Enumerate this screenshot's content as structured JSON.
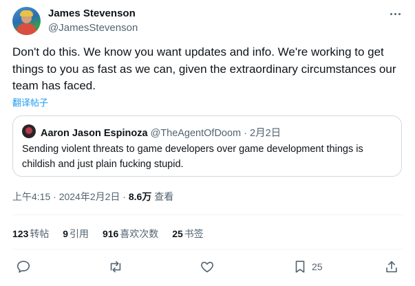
{
  "author": {
    "display_name": "James Stevenson",
    "handle": "@JamesStevenson"
  },
  "tweet": {
    "text": "Don't do this. We know you want updates and info. We're working to get things to you as fast as we can, given the extraordinary circumstances our team has faced.",
    "translate_label": "翻译帖子"
  },
  "quote": {
    "name": "Aaron Jason Espinoza",
    "handle": "@TheAgentOfDoom",
    "separator": " · ",
    "date": "2月2日",
    "text": "Sending violent threats to game developers over game development things is childish and just plain fucking stupid."
  },
  "meta": {
    "time": "上午4:15",
    "separator": " · ",
    "date": "2024年2月2日",
    "separator2": " · ",
    "views_count": "8.6万",
    "views_label": "查看"
  },
  "stats": {
    "reposts": {
      "count": "123",
      "label": "转帖"
    },
    "quotes": {
      "count": "9",
      "label": "引用"
    },
    "likes": {
      "count": "916",
      "label": "喜欢次数"
    },
    "bookmarks": {
      "count": "25",
      "label": "书签"
    }
  },
  "actions": {
    "reply_icon": "reply-icon",
    "repost_icon": "repost-icon",
    "like_icon": "heart-icon",
    "bookmark_icon": "bookmark-icon",
    "bookmark_count": "25",
    "share_icon": "share-icon"
  },
  "colors": {
    "link": "#1d9bf0",
    "secondary_text": "#536471",
    "primary_text": "#0f1419",
    "border": "#cfd9de"
  }
}
